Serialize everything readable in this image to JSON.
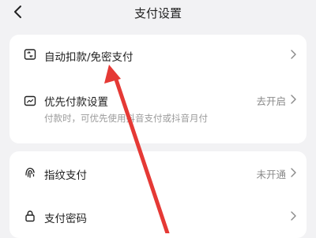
{
  "header": {
    "title": "支付设置",
    "back_icon": "chevron-left-icon"
  },
  "section1": {
    "items": [
      {
        "label": "自动扣款/免密支付",
        "icon": "auto-deduct-icon",
        "status": "",
        "sub": ""
      },
      {
        "label": "优先付款设置",
        "icon": "priority-payment-icon",
        "status": "去开启",
        "sub": "付款时，可优先使用抖音支付或抖音月付"
      }
    ]
  },
  "section2": {
    "items": [
      {
        "label": "指纹支付",
        "icon": "fingerprint-icon",
        "status": "未开通"
      },
      {
        "label": "支付密码",
        "icon": "lock-icon",
        "status": ""
      }
    ]
  },
  "colors": {
    "background": "#f2f2f4",
    "card": "#ffffff",
    "annotation_arrow": "#e53935"
  }
}
